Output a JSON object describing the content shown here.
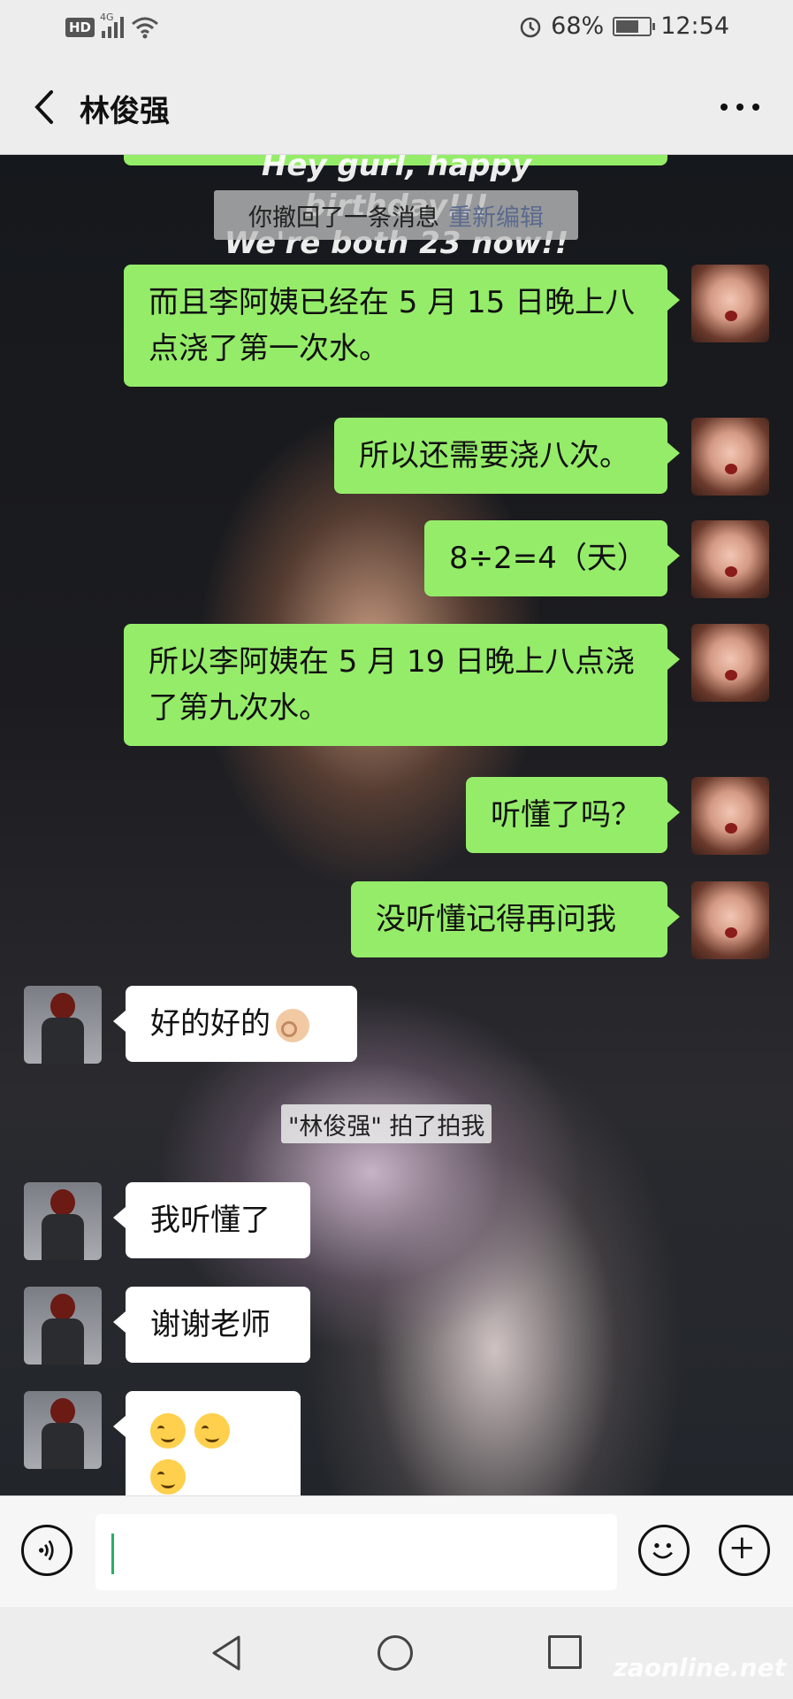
{
  "status_bar": {
    "hd": "HD",
    "network": "4G",
    "battery_percent": "68%",
    "battery_level": 0.68,
    "time": "12:54"
  },
  "header": {
    "title": "林俊强"
  },
  "background_text": {
    "line1": "Hey gurl, happy",
    "line2": "birthday!!!",
    "line3": "We're both 23 now!!"
  },
  "system": {
    "recall_text": "你撤回了一条消息",
    "recall_link": "重新编辑",
    "pat_text": "\"林俊强\" 拍了拍我"
  },
  "messages": [
    {
      "from": "me",
      "text": "而且李阿姨已经在 5 月 15 日晚上八点浇了第一次水。"
    },
    {
      "from": "me",
      "text": "所以还需要浇八次。"
    },
    {
      "from": "me",
      "text": "8÷2=4（天）"
    },
    {
      "from": "me",
      "text": "所以李阿姨在 5 月 19 日晚上八点浇了第九次水。"
    },
    {
      "from": "me",
      "text": "听懂了吗？"
    },
    {
      "from": "me",
      "text": "没听懂记得再问我"
    },
    {
      "from": "them",
      "text": "好的好的",
      "emoji": "ok-hand"
    },
    {
      "from": "them",
      "text": "我听懂了"
    },
    {
      "from": "them",
      "text": "谢谢老师"
    },
    {
      "from": "them",
      "text": "",
      "emoji": "smiling-face x3"
    }
  ],
  "input": {
    "value": ""
  },
  "icons": {
    "back": "chevron-left-icon",
    "more": "more-dots-icon",
    "voice": "voice-icon",
    "emoji": "emoji-icon",
    "plus": "plus-icon"
  },
  "watermark": "zaonline.net",
  "colors": {
    "my_bubble": "#95ec69",
    "their_bubble": "#ffffff",
    "link": "#5b6b8f",
    "caret": "#2aae67"
  }
}
